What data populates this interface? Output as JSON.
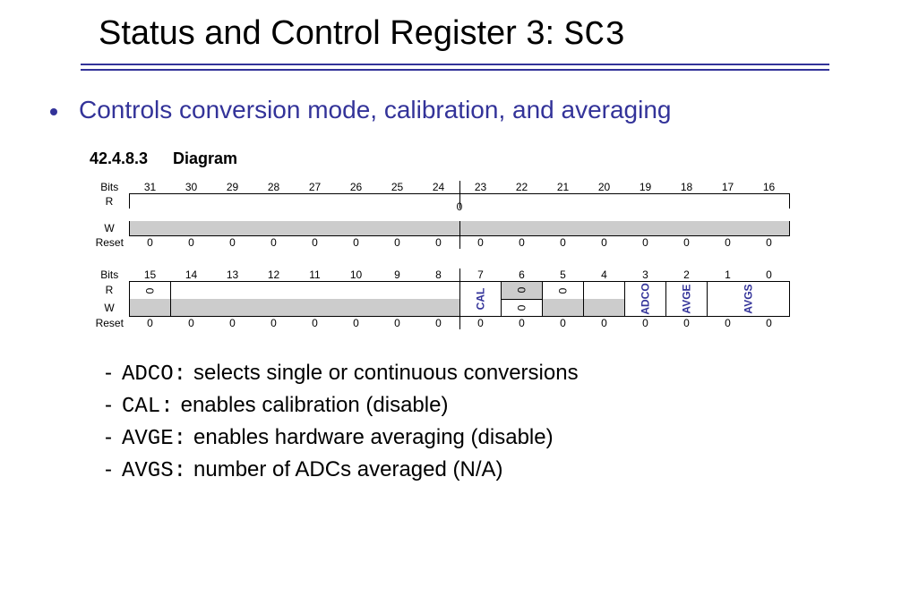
{
  "title": {
    "text": "Status and Control Register 3: ",
    "code": "SC3"
  },
  "subtitle": "Controls conversion mode, calibration, and averaging",
  "diagram": {
    "section_number": "42.4.8.3",
    "section_label": "Diagram",
    "row_labels": {
      "bits": "Bits",
      "r": "R",
      "w": "W",
      "reset": "Reset"
    },
    "upper_bits": [
      "31",
      "30",
      "29",
      "28",
      "27",
      "26",
      "25",
      "24",
      "23",
      "22",
      "21",
      "20",
      "19",
      "18",
      "17",
      "16"
    ],
    "upper_center_label": "0",
    "upper_reset": [
      "0",
      "0",
      "0",
      "0",
      "0",
      "0",
      "0",
      "0",
      "0",
      "0",
      "0",
      "0",
      "0",
      "0",
      "0",
      "0"
    ],
    "lower_bits": [
      "15",
      "14",
      "13",
      "12",
      "11",
      "10",
      "9",
      "8",
      "7",
      "6",
      "5",
      "4",
      "3",
      "2",
      "1",
      "0"
    ],
    "lower_bit15_r": "0",
    "lower_bit6_r": "0",
    "lower_bit6_w": "0",
    "lower_bit5_r": "0",
    "field_labels": {
      "cal": "CAL",
      "adco": "ADCO",
      "avge": "AVGE",
      "avgs": "AVGS"
    },
    "lower_reset": [
      "0",
      "0",
      "0",
      "0",
      "0",
      "0",
      "0",
      "0",
      "0",
      "0",
      "0",
      "0",
      "0",
      "0",
      "0",
      "0"
    ]
  },
  "definitions": [
    {
      "code": "ADCO:",
      "text": "selects single or continuous conversions"
    },
    {
      "code": "CAL:",
      "text": "enables calibration (disable)"
    },
    {
      "code": "AVGE:",
      "text": "enables hardware averaging (disable)"
    },
    {
      "code": "AVGS:",
      "text": "number of ADCs averaged (N/A)"
    }
  ]
}
